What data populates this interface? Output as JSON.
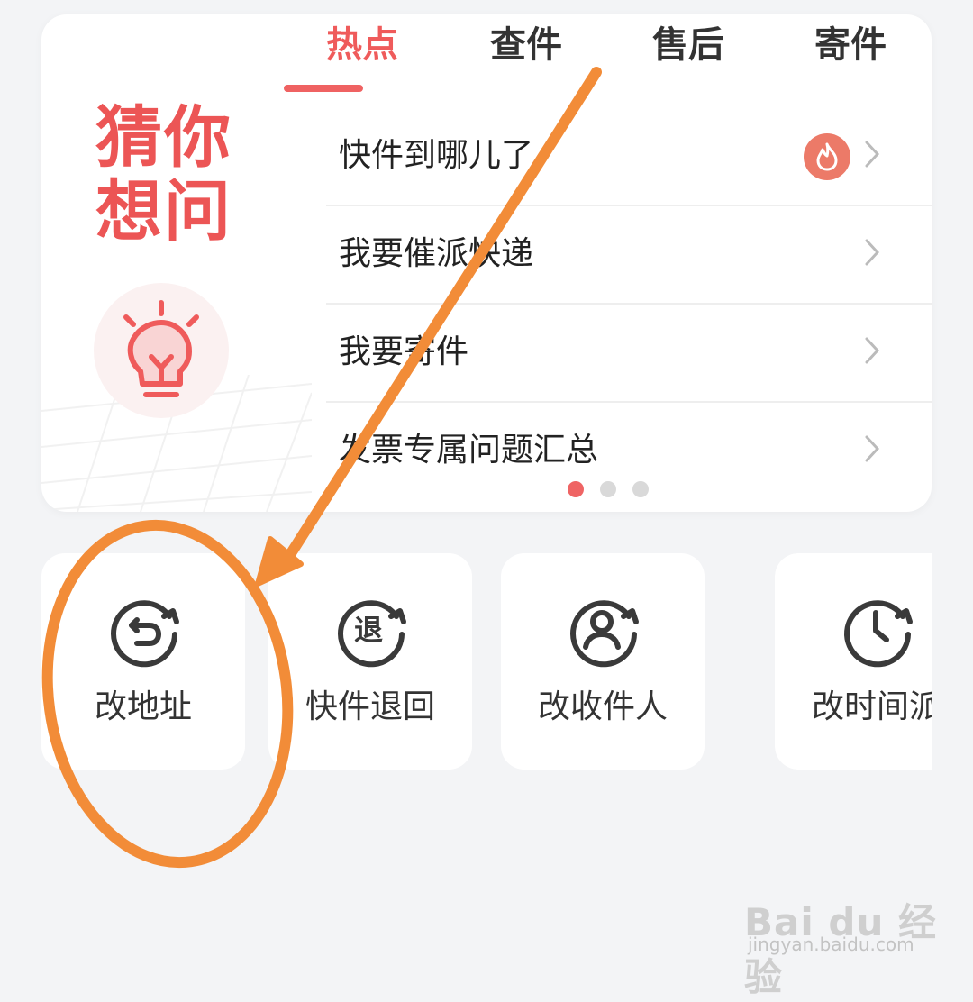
{
  "guess_panel": {
    "title_line1": "猜你",
    "title_line2": "想问",
    "icon": "lightbulb-icon"
  },
  "tabs": [
    {
      "label": "热点",
      "active": true
    },
    {
      "label": "查件",
      "active": false
    },
    {
      "label": "售后",
      "active": false
    },
    {
      "label": "寄件",
      "active": false
    }
  ],
  "questions": [
    {
      "text": "快件到哪儿了",
      "badge": "hot-icon"
    },
    {
      "text": "我要催派快递"
    },
    {
      "text": "我要寄件"
    },
    {
      "text": "发票专属问题汇总"
    }
  ],
  "pager": {
    "pages": 3,
    "current": 1
  },
  "services": [
    {
      "label": "改地址",
      "icon": "change-address-icon"
    },
    {
      "label": "快件退回",
      "icon": "return-icon",
      "icon_text": "退"
    },
    {
      "label": "改收件人",
      "icon": "change-recipient-icon"
    },
    {
      "label": "改时间派",
      "icon": "change-time-icon"
    }
  ],
  "watermark": {
    "brand": "Bai du 经验",
    "url": "jingyan.baidu.com"
  },
  "colors": {
    "accent": "#ef5b5b",
    "annotation": "#f28c38",
    "background": "#f3f4f6"
  }
}
